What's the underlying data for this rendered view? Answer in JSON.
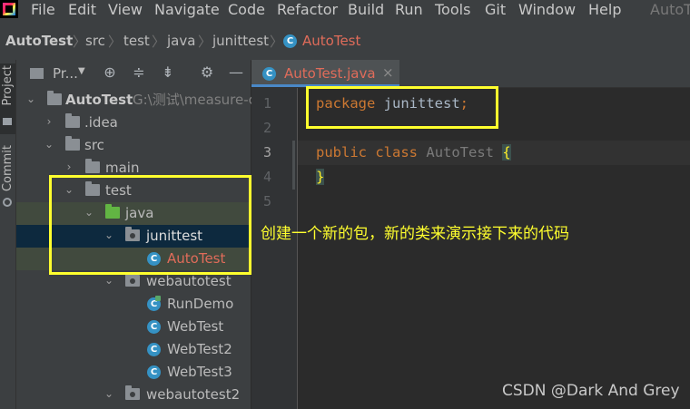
{
  "menu": {
    "items": [
      "File",
      "Edit",
      "View",
      "Navigate",
      "Code",
      "Refactor",
      "Build",
      "Run",
      "Tools",
      "Git",
      "Window",
      "Help"
    ],
    "window_title": "AutoTe"
  },
  "breadcrumb": [
    "AutoTest",
    "src",
    "test",
    "java",
    "junittest",
    "AutoTest"
  ],
  "left_strip": {
    "project_tab": "Project",
    "commit_tab": "Commit"
  },
  "project_panel": {
    "header_label": "Pr...",
    "tree": [
      {
        "label": "AutoTest",
        "path": "G:\\测试\\measure-c"
      },
      {
        "label": ".idea"
      },
      {
        "label": "src"
      },
      {
        "label": "main"
      },
      {
        "label": "test"
      },
      {
        "label": "java"
      },
      {
        "label": "junittest"
      },
      {
        "label": "AutoTest"
      },
      {
        "label": "webautotest"
      },
      {
        "label": "RunDemo"
      },
      {
        "label": "WebTest"
      },
      {
        "label": "WebTest2"
      },
      {
        "label": "WebTest3"
      },
      {
        "label": "webautotest2"
      }
    ]
  },
  "editor": {
    "tab_label": "AutoTest.java",
    "tab_close": "×",
    "line_numbers": [
      "1",
      "2",
      "3",
      "4",
      "5"
    ],
    "code": {
      "l1_kw": "package",
      "l1_name": "junittest",
      "l1_semi": ";",
      "l3_kw1": "public",
      "l3_kw2": "class",
      "l3_name": "AutoTest",
      "l3_brace": "{",
      "l4_brace": "}"
    }
  },
  "annotation": "创建一个新的包，新的类来演示接下来的代码",
  "watermark": "CSDN @Dark And Grey",
  "colors": {
    "highlight_box": "#ffff2e",
    "selection": "#0d293e",
    "class_icon": "#3592c4"
  }
}
